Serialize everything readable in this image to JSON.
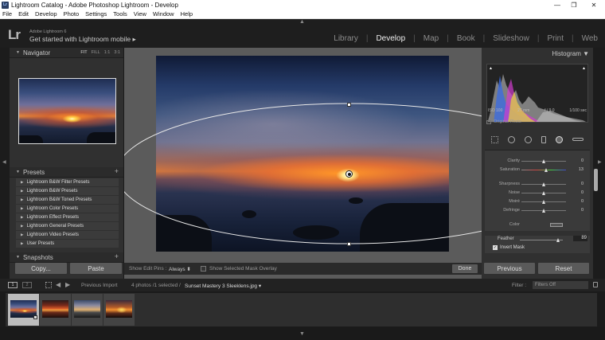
{
  "window": {
    "title": "Lightroom Catalog - Adobe Photoshop Lightroom - Develop",
    "app_icon": "Lr",
    "controls": [
      "—",
      "❐",
      "✕"
    ]
  },
  "menu": [
    "File",
    "Edit",
    "Develop",
    "Photo",
    "Settings",
    "Tools",
    "View",
    "Window",
    "Help"
  ],
  "header": {
    "logo": "Lr",
    "brand_line1": "Adobe Lightroom 6",
    "brand_line2": "Get started with Lightroom mobile ▸",
    "modules": [
      "Library",
      "Develop",
      "Map",
      "Book",
      "Slideshow",
      "Print",
      "Web"
    ],
    "active_module": "Develop"
  },
  "navigator": {
    "title": "Navigator",
    "options": [
      "FIT",
      "FILL",
      "1:1",
      "3:1"
    ],
    "selected_option": "FIT"
  },
  "presets": {
    "title": "Presets",
    "add": "+",
    "items": [
      "Lightroom B&W Filter Presets",
      "Lightroom B&W Presets",
      "Lightroom B&W Toned Presets",
      "Lightroom Color Presets",
      "Lightroom Effect Presets",
      "Lightroom General Presets",
      "Lightroom Video Presets",
      "User Presets"
    ]
  },
  "snapshots": {
    "title": "Snapshots",
    "add": "+"
  },
  "left_buttons": {
    "copy": "Copy...",
    "paste": "Paste"
  },
  "toolbar": {
    "show_edit_pins_label": "Show Edit Pins :",
    "show_edit_pins_value": "Always ⬍",
    "mask_overlay_label": "Show Selected Mask Overlay",
    "done": "Done"
  },
  "histogram": {
    "title": "Histogram ▼",
    "iso": "ISO 100",
    "focal": "27 mm",
    "aperture": "f / 9.0",
    "shutter": "1/100 sec",
    "original_photo": "Original Photo"
  },
  "adjustments": [
    {
      "label": "Clarity",
      "value": "0",
      "pos": 0.5
    },
    {
      "label": "Saturation",
      "value": "13",
      "pos": 0.56
    },
    {
      "label": "Sharpness",
      "value": "0",
      "pos": 0.5
    },
    {
      "label": "Noise",
      "value": "0",
      "pos": 0.5
    },
    {
      "label": "Moiré",
      "value": "0",
      "pos": 0.5
    },
    {
      "label": "Defringe",
      "value": "0",
      "pos": 0.5
    }
  ],
  "color_label": "Color",
  "feather": {
    "label": "Feather",
    "value": "89",
    "pos": 0.89
  },
  "invert_mask": {
    "label": "Invert Mask",
    "checked": true
  },
  "right_buttons": {
    "previous": "Previous",
    "reset": "Reset"
  },
  "filmbar": {
    "screen1": "1",
    "screen2": "2",
    "source": "Previous Import",
    "count": "4 photos /1 selected /",
    "filename": "Sunset Mastery 3 Sleeklens.jpg ▾",
    "filter_label": "Filter :",
    "filter_value": "Filters Off"
  }
}
